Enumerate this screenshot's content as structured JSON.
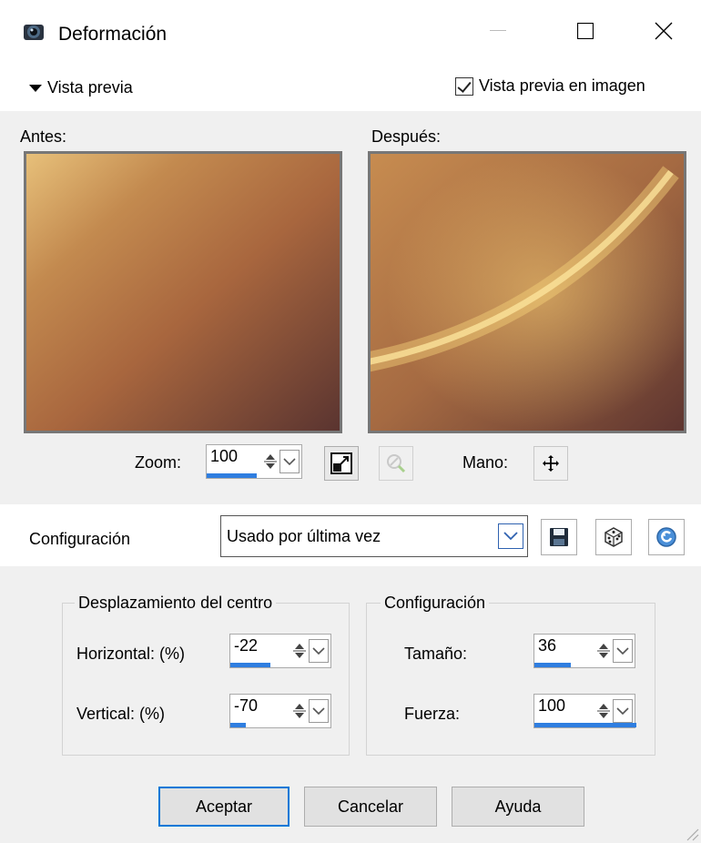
{
  "window": {
    "title": "Deformación",
    "icon": "app-icon",
    "controls": {
      "minimize": "minimize-icon",
      "maximize": "maximize-icon",
      "close": "close-icon"
    }
  },
  "preview": {
    "expander_label": "Vista previa",
    "checkbox_label": "Vista previa en imagen",
    "checkbox_checked": true,
    "before_label": "Antes:",
    "after_label": "Después:"
  },
  "zoom": {
    "label": "Zoom:",
    "value": "100",
    "level_fraction": 0.5,
    "hand_label": "Mano:"
  },
  "config": {
    "label": "Configuración",
    "selected": "Usado por última vez"
  },
  "center_group": {
    "title": "Desplazamiento del centro",
    "horizontal_label": "Horizontal: (%)",
    "horizontal_value": "-22",
    "horizontal_fraction": 0.39,
    "vertical_label": "Vertical: (%)",
    "vertical_value": "-70",
    "vertical_fraction": 0.15
  },
  "settings_group": {
    "title": "Configuración",
    "size_label": "Tamaño:",
    "size_value": "36",
    "size_fraction": 0.36,
    "strength_label": "Fuerza:",
    "strength_value": "100",
    "strength_fraction": 1.0
  },
  "buttons": {
    "accept": "Aceptar",
    "cancel": "Cancelar",
    "help": "Ayuda"
  },
  "colors": {
    "accent": "#2f7ee0",
    "dialog_bg": "#f0f0f0"
  }
}
